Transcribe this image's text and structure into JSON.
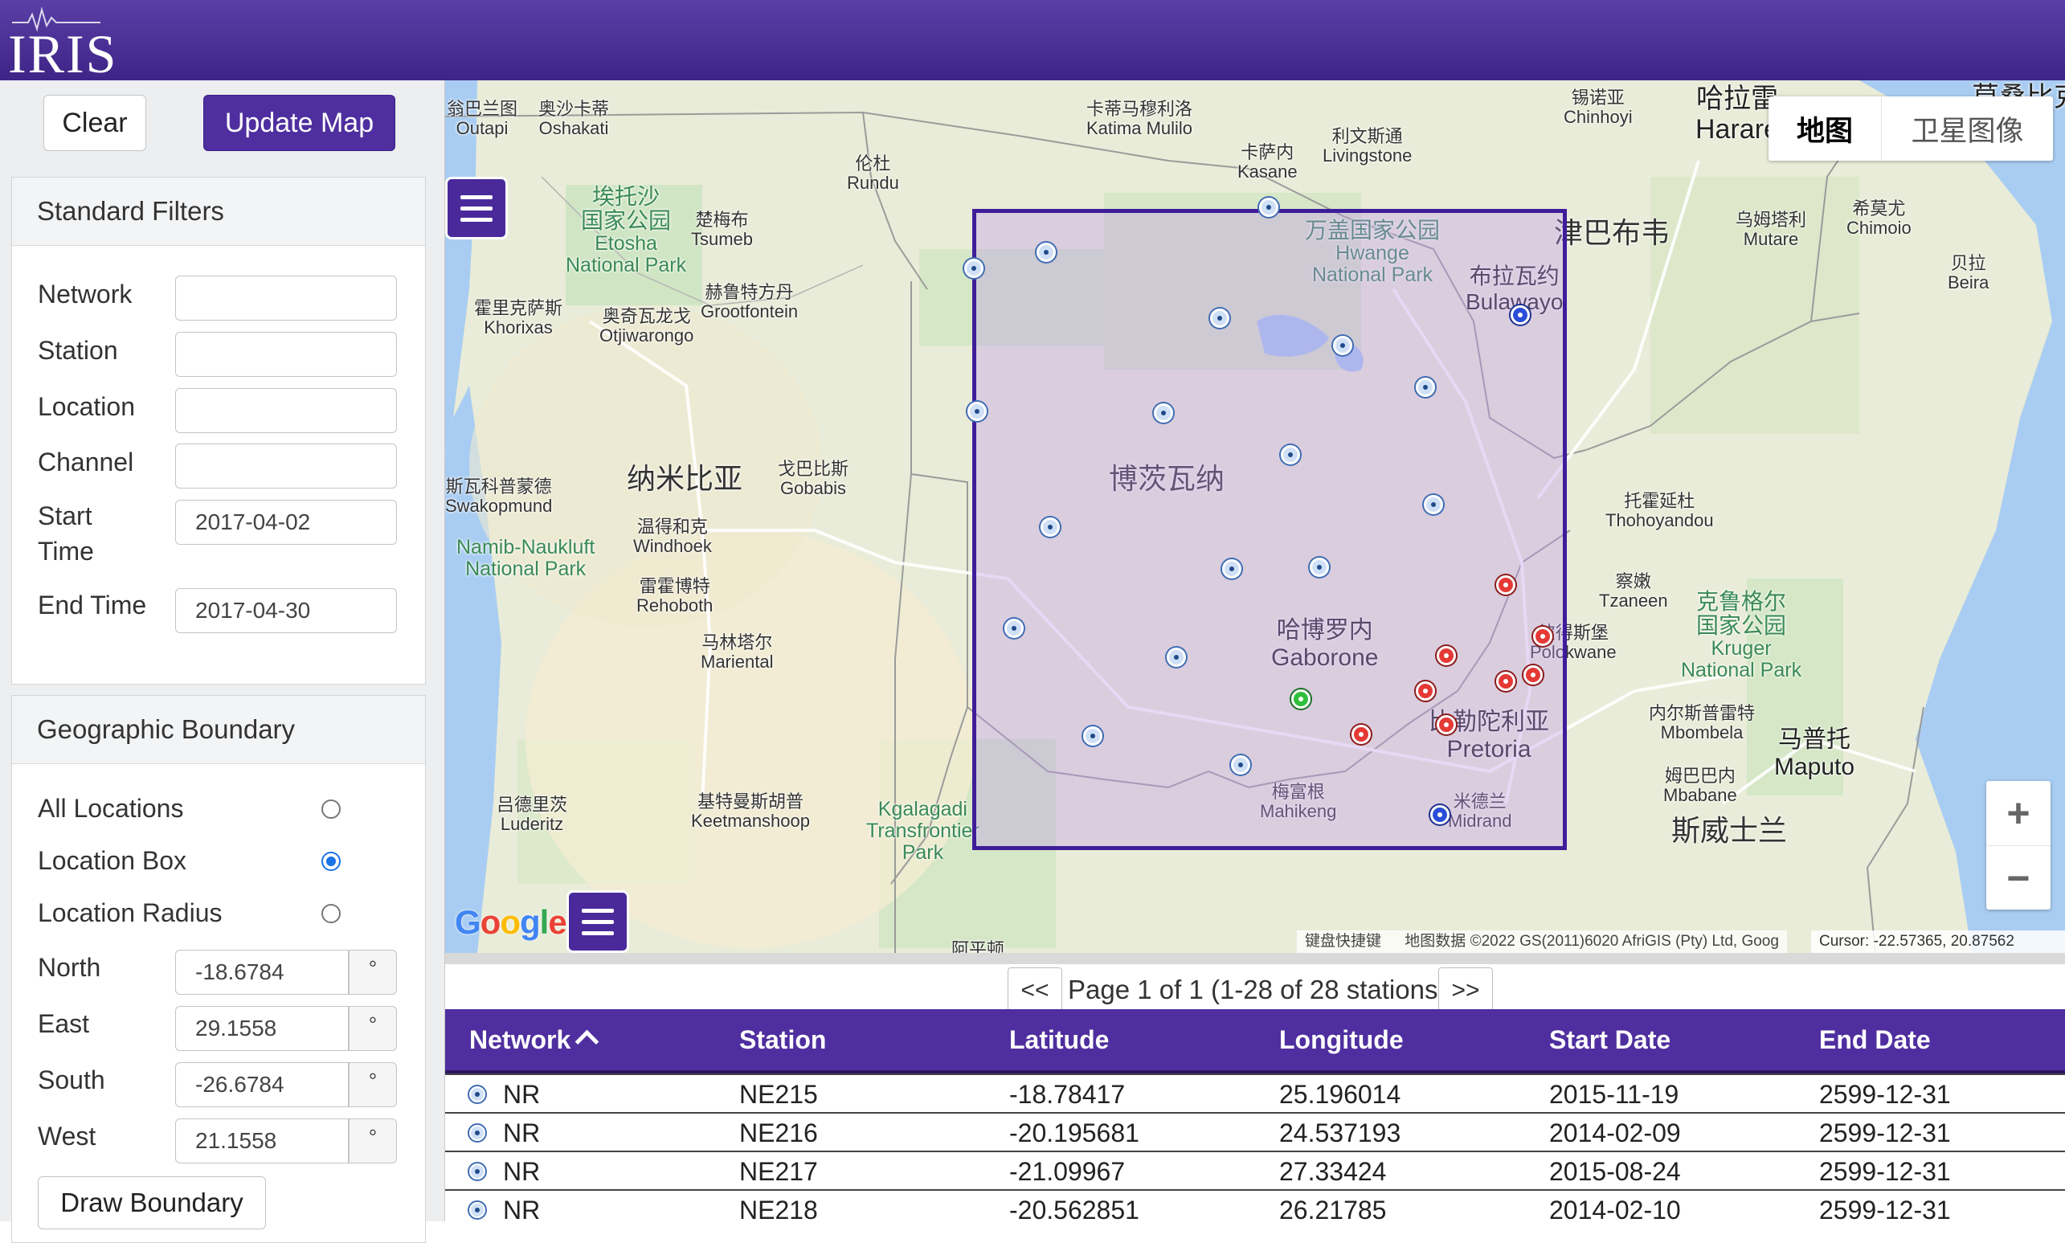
{
  "header": {
    "logo_text": "IRIS"
  },
  "sidebar": {
    "clear_label": "Clear",
    "update_label": "Update Map",
    "standard_filters": {
      "title": "Standard Filters",
      "network_label": "Network",
      "station_label": "Station",
      "location_label": "Location",
      "channel_label": "Channel",
      "start_time_label_1": "Start",
      "start_time_label_2": "Time",
      "start_time_value": "2017-04-02",
      "end_time_label": "End Time",
      "end_time_value": "2017-04-30"
    },
    "geo": {
      "title": "Geographic Boundary",
      "all_locations": "All Locations",
      "location_box": "Location Box",
      "location_radius": "Location Radius",
      "selected": "Location Box",
      "north_label": "North",
      "north_value": "-18.6784",
      "east_label": "East",
      "east_value": "29.1558",
      "south_label": "South",
      "south_value": "-26.6784",
      "west_label": "West",
      "west_value": "21.1558",
      "degree_symbol": "°",
      "draw_label": "Draw Boundary"
    }
  },
  "map": {
    "type_map": "地图",
    "type_satellite": "卫星图像",
    "zoom_in": "+",
    "zoom_out": "−",
    "google_text": "Google",
    "attribution_keys": "键盘快捷键",
    "attribution_data": "地图数据 ©2022 GS(2011)6020 AfriGIS (Pty) Ltd, Goog",
    "cursor_text": "Cursor: -22.57365, 20.87562",
    "labels": {
      "outapi_cn": "翁巴兰图",
      "outapi": "Outapi",
      "oshakati_cn": "奥沙卡蒂",
      "oshakati": "Oshakati",
      "katima_cn": "卡蒂马穆利洛",
      "katima": "Katima Mulilo",
      "kasane_cn": "卡萨内",
      "kasane": "Kasane",
      "livingstone_cn": "利文斯通",
      "livingstone": "Livingstone",
      "chinhoyi_cn": "锡诺亚",
      "chinhoyi": "Chinhoyi",
      "harare_cn": "哈拉雷",
      "harare": "Harare",
      "rundu_cn": "伦杜",
      "rundu": "Rundu",
      "etosha_cn1": "埃托沙",
      "etosha_cn2": "国家公园",
      "etosha_1": "Etosha",
      "etosha_2": "National Park",
      "tsumeb_cn": "楚梅布",
      "tsumeb": "Tsumeb",
      "hwange_cn": "万盖国家公园",
      "hwange_1": "Hwange",
      "hwange_2": "National Park",
      "zimbabwe_cn": "津巴布韦",
      "mutare_cn": "乌姆塔利",
      "mutare": "Mutare",
      "chimoio_cn": "希莫尤",
      "chimoio": "Chimoio",
      "beira_cn": "贝拉",
      "beira": "Beira",
      "khorixas_cn": "霍里克萨斯",
      "khorixas": "Khorixas",
      "otjiwarongo_cn": "奥奇瓦龙戈",
      "otjiwarongo": "Otjiwarongo",
      "grootfontein_cn": "赫鲁特方丹",
      "grootfontein": "Grootfontein",
      "bulawayo_cn": "布拉瓦约",
      "bulawayo": "Bulawayo",
      "namibia_cn": "纳米比亚",
      "gobabis_cn": "戈巴比斯",
      "gobabis": "Gobabis",
      "swakopmund_cn": "斯瓦科普蒙德",
      "swakopmund": "Swakopmund",
      "botswana_cn": "博茨瓦纳",
      "windhoek_cn": "温得和克",
      "windhoek": "Windhoek",
      "naukluft_1": "Namib-Naukluft",
      "naukluft_2": "National Park",
      "rehoboth_cn": "雷霍博特",
      "rehoboth": "Rehoboth",
      "thohoyandou_cn": "托霍延杜",
      "thohoyandou": "Thohoyandou",
      "tzaneen_cn": "察嫩",
      "tzaneen": "Tzaneen",
      "kruger_cn1": "克鲁格尔",
      "kruger_cn2": "国家公园",
      "kruger_1": "Kruger",
      "kruger_2": "National Park",
      "gaborone_cn": "哈博罗内",
      "gaborone": "Gaborone",
      "polokwane_cn": "彼得斯堡",
      "polokwane": "Polokwane",
      "mariental_cn": "马林塔尔",
      "mariental": "Mariental",
      "pretoria_cn": "比勒陀利亚",
      "pretoria": "Pretoria",
      "mbombela_cn": "内尔斯普雷特",
      "mbombela": "Mbombela",
      "maputo_cn": "马普托",
      "maputo": "Maputo",
      "mbabane_cn": "姆巴巴内",
      "mbabane": "Mbabane",
      "luderitz_cn": "吕德里茨",
      "luderitz": "Luderitz",
      "keetmanshoop_cn": "基特曼斯胡普",
      "keetmanshoop": "Keetmanshoop",
      "kgalagadi_1": "Kgalagadi",
      "kgalagadi_2": "Transfrontier",
      "kgalagadi_3": "Park",
      "mahikeng_cn": "梅富根",
      "mahikeng": "Mahikeng",
      "midrand_cn": "米德兰",
      "midrand": "Midrand",
      "eswatini_cn": "斯威士兰",
      "top_right_cn": "莫桑比克",
      "bottom_cut": "阿平顿"
    }
  },
  "pager": {
    "prev": "<<",
    "next": ">>",
    "text": "Page 1 of 1 (1-28 of 28 stations)"
  },
  "table": {
    "headers": {
      "network": "Network",
      "station": "Station",
      "latitude": "Latitude",
      "longitude": "Longitude",
      "start_date": "Start Date",
      "end_date": "End Date"
    },
    "rows": [
      {
        "network": "NR",
        "station": "NE215",
        "latitude": "-18.78417",
        "longitude": "25.196014",
        "start": "2015-11-19",
        "end": "2599-12-31"
      },
      {
        "network": "NR",
        "station": "NE216",
        "latitude": "-20.195681",
        "longitude": "24.537193",
        "start": "2014-02-09",
        "end": "2599-12-31"
      },
      {
        "network": "NR",
        "station": "NE217",
        "latitude": "-21.09967",
        "longitude": "27.33424",
        "start": "2015-08-24",
        "end": "2599-12-31"
      },
      {
        "network": "NR",
        "station": "NE218",
        "latitude": "-20.562851",
        "longitude": "26.21785",
        "start": "2014-02-10",
        "end": "2599-12-31"
      }
    ]
  },
  "colors": {
    "brand": "#4f2f9f",
    "box": "#3f1c9a",
    "station_red": "#e53935",
    "station_blue": "#2a4ed8",
    "station_green": "#2fbf3b"
  }
}
